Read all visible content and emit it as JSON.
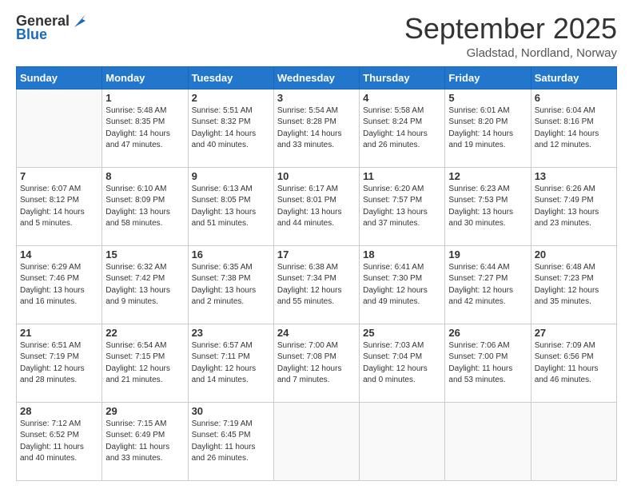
{
  "logo": {
    "general": "General",
    "blue": "Blue"
  },
  "header": {
    "month": "September 2025",
    "location": "Gladstad, Nordland, Norway"
  },
  "days_of_week": [
    "Sunday",
    "Monday",
    "Tuesday",
    "Wednesday",
    "Thursday",
    "Friday",
    "Saturday"
  ],
  "weeks": [
    [
      {
        "day": "",
        "info": ""
      },
      {
        "day": "1",
        "info": "Sunrise: 5:48 AM\nSunset: 8:35 PM\nDaylight: 14 hours\nand 47 minutes."
      },
      {
        "day": "2",
        "info": "Sunrise: 5:51 AM\nSunset: 8:32 PM\nDaylight: 14 hours\nand 40 minutes."
      },
      {
        "day": "3",
        "info": "Sunrise: 5:54 AM\nSunset: 8:28 PM\nDaylight: 14 hours\nand 33 minutes."
      },
      {
        "day": "4",
        "info": "Sunrise: 5:58 AM\nSunset: 8:24 PM\nDaylight: 14 hours\nand 26 minutes."
      },
      {
        "day": "5",
        "info": "Sunrise: 6:01 AM\nSunset: 8:20 PM\nDaylight: 14 hours\nand 19 minutes."
      },
      {
        "day": "6",
        "info": "Sunrise: 6:04 AM\nSunset: 8:16 PM\nDaylight: 14 hours\nand 12 minutes."
      }
    ],
    [
      {
        "day": "7",
        "info": "Sunrise: 6:07 AM\nSunset: 8:12 PM\nDaylight: 14 hours\nand 5 minutes."
      },
      {
        "day": "8",
        "info": "Sunrise: 6:10 AM\nSunset: 8:09 PM\nDaylight: 13 hours\nand 58 minutes."
      },
      {
        "day": "9",
        "info": "Sunrise: 6:13 AM\nSunset: 8:05 PM\nDaylight: 13 hours\nand 51 minutes."
      },
      {
        "day": "10",
        "info": "Sunrise: 6:17 AM\nSunset: 8:01 PM\nDaylight: 13 hours\nand 44 minutes."
      },
      {
        "day": "11",
        "info": "Sunrise: 6:20 AM\nSunset: 7:57 PM\nDaylight: 13 hours\nand 37 minutes."
      },
      {
        "day": "12",
        "info": "Sunrise: 6:23 AM\nSunset: 7:53 PM\nDaylight: 13 hours\nand 30 minutes."
      },
      {
        "day": "13",
        "info": "Sunrise: 6:26 AM\nSunset: 7:49 PM\nDaylight: 13 hours\nand 23 minutes."
      }
    ],
    [
      {
        "day": "14",
        "info": "Sunrise: 6:29 AM\nSunset: 7:46 PM\nDaylight: 13 hours\nand 16 minutes."
      },
      {
        "day": "15",
        "info": "Sunrise: 6:32 AM\nSunset: 7:42 PM\nDaylight: 13 hours\nand 9 minutes."
      },
      {
        "day": "16",
        "info": "Sunrise: 6:35 AM\nSunset: 7:38 PM\nDaylight: 13 hours\nand 2 minutes."
      },
      {
        "day": "17",
        "info": "Sunrise: 6:38 AM\nSunset: 7:34 PM\nDaylight: 12 hours\nand 55 minutes."
      },
      {
        "day": "18",
        "info": "Sunrise: 6:41 AM\nSunset: 7:30 PM\nDaylight: 12 hours\nand 49 minutes."
      },
      {
        "day": "19",
        "info": "Sunrise: 6:44 AM\nSunset: 7:27 PM\nDaylight: 12 hours\nand 42 minutes."
      },
      {
        "day": "20",
        "info": "Sunrise: 6:48 AM\nSunset: 7:23 PM\nDaylight: 12 hours\nand 35 minutes."
      }
    ],
    [
      {
        "day": "21",
        "info": "Sunrise: 6:51 AM\nSunset: 7:19 PM\nDaylight: 12 hours\nand 28 minutes."
      },
      {
        "day": "22",
        "info": "Sunrise: 6:54 AM\nSunset: 7:15 PM\nDaylight: 12 hours\nand 21 minutes."
      },
      {
        "day": "23",
        "info": "Sunrise: 6:57 AM\nSunset: 7:11 PM\nDaylight: 12 hours\nand 14 minutes."
      },
      {
        "day": "24",
        "info": "Sunrise: 7:00 AM\nSunset: 7:08 PM\nDaylight: 12 hours\nand 7 minutes."
      },
      {
        "day": "25",
        "info": "Sunrise: 7:03 AM\nSunset: 7:04 PM\nDaylight: 12 hours\nand 0 minutes."
      },
      {
        "day": "26",
        "info": "Sunrise: 7:06 AM\nSunset: 7:00 PM\nDaylight: 11 hours\nand 53 minutes."
      },
      {
        "day": "27",
        "info": "Sunrise: 7:09 AM\nSunset: 6:56 PM\nDaylight: 11 hours\nand 46 minutes."
      }
    ],
    [
      {
        "day": "28",
        "info": "Sunrise: 7:12 AM\nSunset: 6:52 PM\nDaylight: 11 hours\nand 40 minutes."
      },
      {
        "day": "29",
        "info": "Sunrise: 7:15 AM\nSunset: 6:49 PM\nDaylight: 11 hours\nand 33 minutes."
      },
      {
        "day": "30",
        "info": "Sunrise: 7:19 AM\nSunset: 6:45 PM\nDaylight: 11 hours\nand 26 minutes."
      },
      {
        "day": "",
        "info": ""
      },
      {
        "day": "",
        "info": ""
      },
      {
        "day": "",
        "info": ""
      },
      {
        "day": "",
        "info": ""
      }
    ]
  ]
}
